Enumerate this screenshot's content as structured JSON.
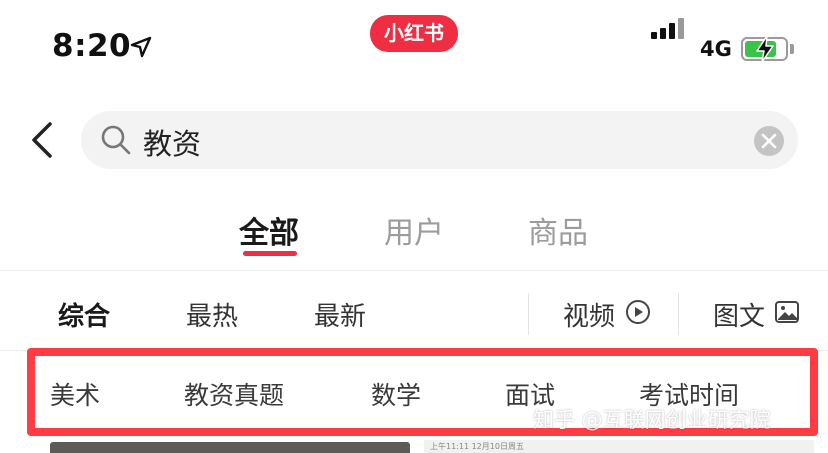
{
  "status_bar": {
    "time": "8:20",
    "network": "4G",
    "battery_level": 0.75,
    "battery_color": "#3ac34b"
  },
  "app": {
    "logo_text": "小红书",
    "brand_color": "#ef2d43"
  },
  "search": {
    "query": "教资"
  },
  "tabs": [
    {
      "label": "全部",
      "active": true
    },
    {
      "label": "用户",
      "active": false
    },
    {
      "label": "商品",
      "active": false
    }
  ],
  "sort_options": [
    {
      "label": "综合",
      "active": true
    },
    {
      "label": "最热",
      "active": false
    },
    {
      "label": "最新",
      "active": false
    }
  ],
  "filters": {
    "video_label": "视频",
    "image_text_label": "图文"
  },
  "topic_chips": [
    "美术",
    "教资真题",
    "数学",
    "面试",
    "考试时间"
  ],
  "watermark": "知乎 @互联网创业研究院",
  "highlight_color": "#ff3b44",
  "card_preview_text": "上午11:11  12月10日周五"
}
